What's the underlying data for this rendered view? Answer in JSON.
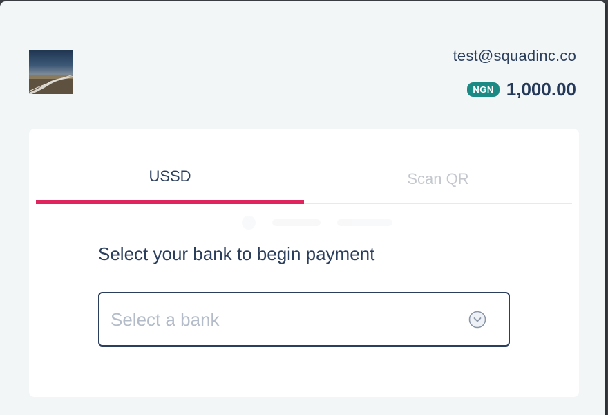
{
  "header": {
    "email": "test@squadinc.co",
    "currency": "NGN",
    "amount": "1,000.00"
  },
  "tabs": [
    {
      "label": "USSD",
      "active": true
    },
    {
      "label": "Scan QR",
      "active": false
    }
  ],
  "ussd": {
    "instruction": "Select your bank to begin payment",
    "bank_select": {
      "placeholder": "Select a bank",
      "value": ""
    }
  },
  "icons": {
    "merchant_logo": "merchant-logo-image",
    "select_chevron": "chevron-down-icon"
  },
  "colors": {
    "accent": "#e0245e",
    "badge": "#1b8a85",
    "text": "#2b3e5c",
    "background": "#f2f6f7"
  }
}
